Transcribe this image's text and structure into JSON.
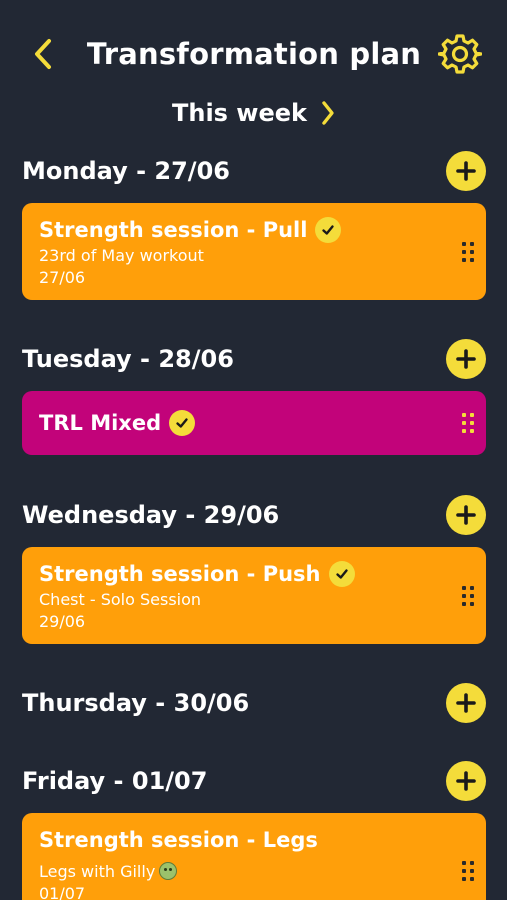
{
  "colors": {
    "background": "#222834",
    "accent": "#f4dc3a",
    "strength_card": "#ff9f0a",
    "mixed_card": "#c2037a",
    "text": "#ffffff"
  },
  "header": {
    "back_icon": "chevron-left-icon",
    "title": "Transformation plan",
    "settings_icon": "gear-icon"
  },
  "week_nav": {
    "label": "This week",
    "next_icon": "chevron-right-icon"
  },
  "days": [
    {
      "label": "Monday - 27/06",
      "add_icon": "plus-icon",
      "workouts": [
        {
          "title": "Strength session - Pull",
          "completed": true,
          "subtitle": "23rd of May workout",
          "date": "27/06",
          "color": "#ff9f0a"
        }
      ]
    },
    {
      "label": "Tuesday - 28/06",
      "add_icon": "plus-icon",
      "workouts": [
        {
          "title": "TRL Mixed",
          "completed": true,
          "color": "#c2037a"
        }
      ]
    },
    {
      "label": "Wednesday - 29/06",
      "add_icon": "plus-icon",
      "workouts": [
        {
          "title": "Strength session - Push",
          "completed": true,
          "subtitle": "Chest - Solo Session",
          "date": "29/06",
          "color": "#ff9f0a"
        }
      ]
    },
    {
      "label": "Thursday - 30/06",
      "add_icon": "plus-icon",
      "workouts": []
    },
    {
      "label": "Friday - 01/07",
      "add_icon": "plus-icon",
      "workouts": [
        {
          "title": "Strength session - Legs",
          "completed": false,
          "subtitle": "Legs with Gilly",
          "subtitle_icon": "nauseated-face-emoji-icon",
          "date": "01/07",
          "color": "#ff9f0a"
        }
      ]
    }
  ]
}
